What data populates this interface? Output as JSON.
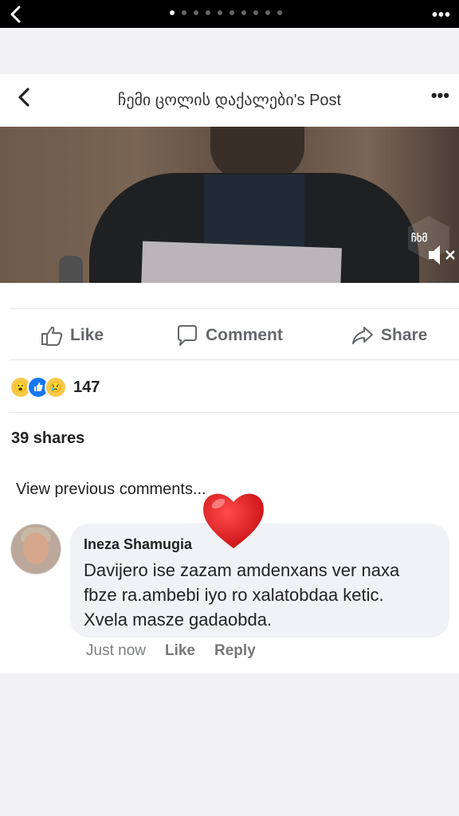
{
  "status_bar": {
    "page_count": 10,
    "active_page": 1
  },
  "header": {
    "title": "ჩემი ცოლის დაქალები's Post"
  },
  "video": {
    "channel_logo_text": "ჩხმ"
  },
  "actions": {
    "like": "Like",
    "comment": "Comment",
    "share": "Share"
  },
  "reactions": {
    "count": "147",
    "icons": [
      "wow-icon",
      "like-icon",
      "sad-icon"
    ]
  },
  "shares": "39 shares",
  "comments": {
    "view_previous": "View previous comments...",
    "items": [
      {
        "author": "Ineza Shamugia",
        "text": "Davijero ise zazam amdenxans ver naxa fbze ra.ambebi iyo ro xalatobdaa ketic. Xvela masze gadaobda.",
        "time": "Just now",
        "like": "Like",
        "reply": "Reply"
      }
    ]
  },
  "colors": {
    "like_blue": "#1877f2",
    "heart_red": "#e51b23"
  }
}
